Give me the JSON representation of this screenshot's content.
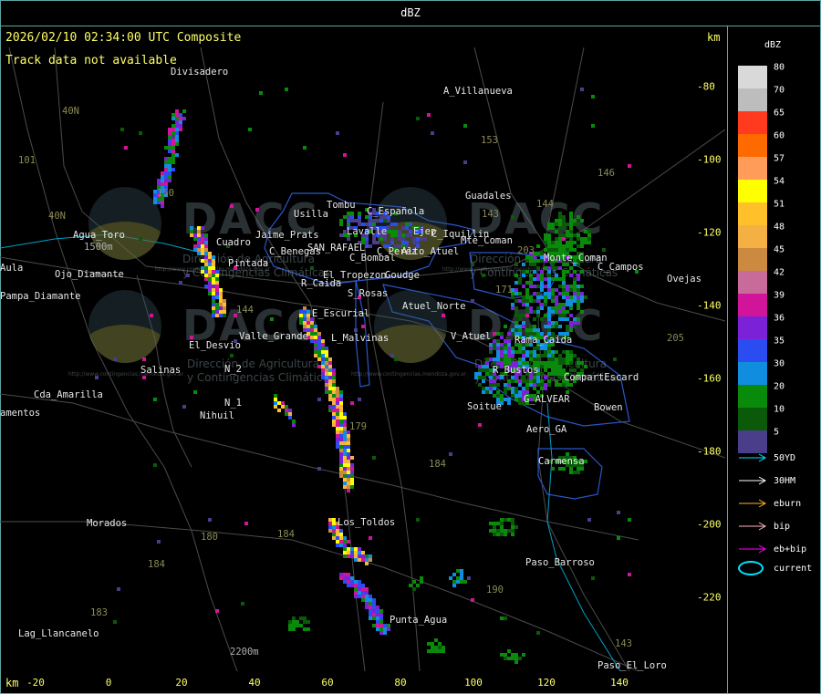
{
  "top_bar": {
    "title": "dBZ"
  },
  "map": {
    "header": "2026/02/10 02:34:00 UTC Composite",
    "track_msg": "Track data not available",
    "km_label": "km",
    "x_ticks": [
      "-20",
      "0",
      "20",
      "40",
      "60",
      "80",
      "100",
      "120",
      "140"
    ],
    "y_ticks": [
      "-80",
      "-100",
      "-120",
      "-140",
      "-160",
      "-180",
      "-200",
      "-220"
    ],
    "places": [
      "Divisadero",
      "A_Villanueva",
      "Guadales",
      "Usilla",
      "Tombu",
      "C_Española",
      "Lavalle",
      "C_Benegas",
      "SAN_RAFAEL",
      "Ejep",
      "C_Iquillin",
      "Mte_Coman",
      "C_Bombal",
      "El_Tropezon",
      "Goudge",
      "R_Caida",
      "S_Rosas",
      "Atuel_Norte",
      "E_Escurial",
      "Valle_Grande",
      "L_Malvinas",
      "El_Desvio",
      "Salinas",
      "Cda_Amarilla",
      "N_2",
      "N_1",
      "Nihuil",
      "Agua_Toro",
      "Pampa_Diamante",
      "Los_Toldos",
      "Morados",
      "Lag_Llancanelo",
      "Punta_Agua",
      "Paso_Barroso",
      "Paso_El_Loro",
      "Monte_Coman",
      "C_Campos",
      "Ovejas",
      "V_Atuel",
      "Rama_Caida",
      "R_Bustos",
      "CompartEscard",
      "G_ALVEAR",
      "Bowen",
      "Soitue",
      "Aero_GA",
      "Carmensa",
      "Pintada",
      "Cuadro",
      "Jaime_Prats",
      "Ojo_Diamante",
      "Aula",
      "amentos",
      "C_Perez",
      "Alto_Atuel"
    ],
    "roads": [
      "101",
      "40N",
      "40N",
      "150",
      "153",
      "146",
      "143",
      "144",
      "203",
      "171",
      "205",
      "179",
      "184",
      "180",
      "184",
      "183",
      "184",
      "190",
      "143",
      "144"
    ],
    "elevations": [
      "1500m",
      "2200m"
    ],
    "watermark": {
      "brand": "DACC",
      "sub_1": "Dirección de Agricultura",
      "sub_2": "y Contingencias Climáticas",
      "url": "http://www.contingencias.mendoza.gov.ar"
    }
  },
  "legend": {
    "title": "dBZ",
    "scale": [
      {
        "v": "80",
        "c": "#d9d9d9"
      },
      {
        "v": "70",
        "c": "#bdbdbd"
      },
      {
        "v": "65",
        "c": "#ff3a1f"
      },
      {
        "v": "60",
        "c": "#ff6a00"
      },
      {
        "v": "57",
        "c": "#ff9c5a"
      },
      {
        "v": "54",
        "c": "#ffff00"
      },
      {
        "v": "51",
        "c": "#ffc02a"
      },
      {
        "v": "48",
        "c": "#f4b043"
      },
      {
        "v": "45",
        "c": "#cc8a40"
      },
      {
        "v": "42",
        "c": "#c86a9a"
      },
      {
        "v": "39",
        "c": "#d1159a"
      },
      {
        "v": "36",
        "c": "#7b22d8"
      },
      {
        "v": "35",
        "c": "#2b4cf0"
      },
      {
        "v": "30",
        "c": "#118de0"
      },
      {
        "v": "20",
        "c": "#0a8a0a"
      },
      {
        "v": "10",
        "c": "#0a5a0a"
      },
      {
        "v": "5",
        "c": "#4a3d8a"
      }
    ],
    "tracks": [
      {
        "label": "50YD",
        "color": "#00e5ff"
      },
      {
        "label": "30HM",
        "color": "#ffffff"
      },
      {
        "label": "eburn",
        "color": "#ffb030"
      },
      {
        "label": "bip",
        "color": "#ffb6c1"
      },
      {
        "label": "eb+bip",
        "color": "#ff00ff"
      }
    ],
    "current_label": "current"
  }
}
